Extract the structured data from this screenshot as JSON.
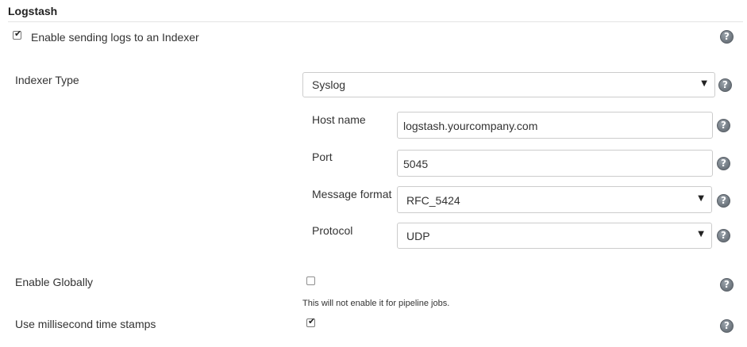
{
  "section": {
    "title": "Logstash"
  },
  "enable_sending": {
    "label": "Enable sending logs to an Indexer",
    "checked": true
  },
  "indexer_type": {
    "label": "Indexer Type",
    "value": "Syslog"
  },
  "syslog": {
    "host_name": {
      "label": "Host name",
      "value": "logstash.yourcompany.com"
    },
    "port": {
      "label": "Port",
      "value": "5045"
    },
    "message_format": {
      "label": "Message format",
      "value": "RFC_5424"
    },
    "protocol": {
      "label": "Protocol",
      "value": "UDP"
    }
  },
  "enable_globally": {
    "label": "Enable Globally",
    "checked": false,
    "note": "This will not enable it for pipeline jobs."
  },
  "millisecond_timestamps": {
    "label": "Use millisecond time stamps",
    "checked": true
  },
  "icons": {
    "help": "help-icon",
    "dropdown": "chevron-down-icon",
    "check": "check-icon"
  },
  "help_glyph": "?",
  "dropdown_glyph": "▼",
  "check_glyph": "✔"
}
